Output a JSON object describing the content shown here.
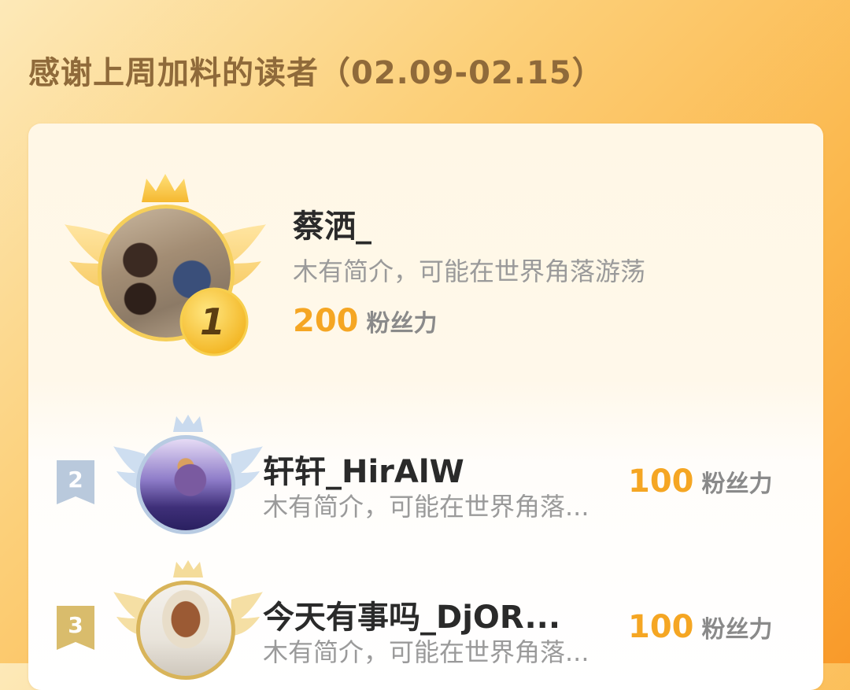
{
  "header": {
    "title": "感谢上周加料的读者（02.09-02.15）"
  },
  "top_reader": {
    "rank": "1",
    "name": "蔡洒_",
    "intro": "木有简介，可能在世界角落游荡",
    "power_value": "200",
    "power_unit": "粉丝力"
  },
  "readers": [
    {
      "rank": "2",
      "name": "轩轩_HirAlW",
      "intro": "木有简介，可能在世界角落...",
      "power_value": "100",
      "power_unit": "粉丝力"
    },
    {
      "rank": "3",
      "name": "今天有事吗_DjOR...",
      "intro": "木有简介，可能在世界角落...",
      "power_value": "100",
      "power_unit": "粉丝力"
    }
  ],
  "colors": {
    "accent": "#f5a623",
    "title": "#8f6a3a",
    "rank2_badge": "#b9c9dc",
    "rank3_badge": "#d9bc6c"
  }
}
